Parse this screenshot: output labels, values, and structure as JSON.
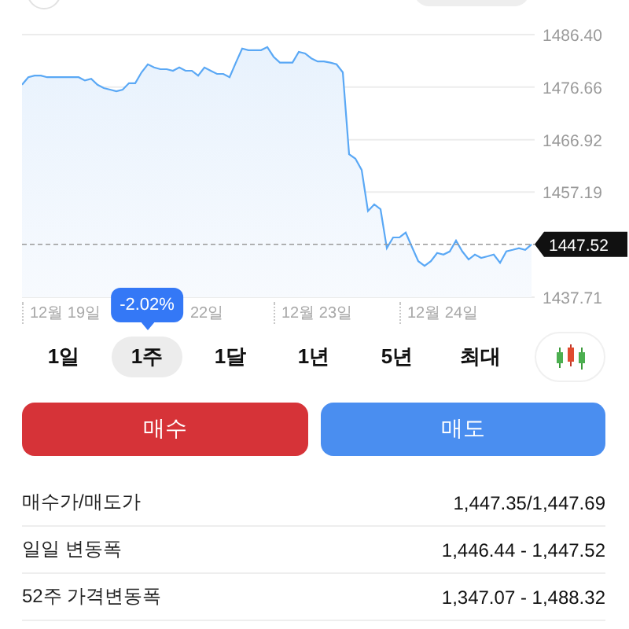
{
  "price_chart": {
    "chart_data": {
      "type": "area",
      "grid": true,
      "ylim": [
        1437.71,
        1486.4
      ],
      "yticks": [
        {
          "value": 1486.4,
          "label": "1486.40"
        },
        {
          "value": 1476.66,
          "label": "1476.66"
        },
        {
          "value": 1466.92,
          "label": "1466.92"
        },
        {
          "value": 1457.19,
          "label": "1457.19"
        },
        {
          "value": 1437.71,
          "label": "1437.71"
        }
      ],
      "series": [
        {
          "color": "#5aa8f5",
          "values": [
            1477.1,
            1478.5,
            1478.8,
            1478.8,
            1478.5,
            1478.5,
            1478.5,
            1478.5,
            1478.5,
            1478.5,
            1477.9,
            1478.2,
            1477.1,
            1476.5,
            1476.2,
            1475.9,
            1476.2,
            1477.4,
            1477.4,
            1479.4,
            1480.9,
            1480.3,
            1480.0,
            1480.0,
            1479.7,
            1480.3,
            1479.7,
            1479.7,
            1478.8,
            1480.3,
            1479.7,
            1479.1,
            1479.1,
            1478.5,
            1481.2,
            1483.8,
            1483.5,
            1483.5,
            1483.5,
            1484.1,
            1482.3,
            1481.2,
            1481.2,
            1481.2,
            1483.2,
            1482.9,
            1482.0,
            1481.4,
            1481.4,
            1481.2,
            1480.9,
            1479.4,
            1464.2,
            1463.4,
            1461.3,
            1453.7,
            1454.9,
            1454.0,
            1446.8,
            1448.8,
            1448.8,
            1449.7,
            1447.0,
            1444.4,
            1443.5,
            1444.4,
            1445.9,
            1445.6,
            1446.2,
            1448.2,
            1446.2,
            1444.7,
            1445.6,
            1445.0,
            1445.3,
            1445.6,
            1444.1,
            1446.2,
            1446.5,
            1446.8,
            1446.5,
            1447.52
          ]
        }
      ],
      "ref_lines": [
        {
          "axis": "y",
          "value": 1447.52,
          "label": "1447.52"
        }
      ]
    },
    "date_labels": [
      {
        "label": "12월 19일",
        "clipped": false
      },
      {
        "label": "22일",
        "clipped": true
      },
      {
        "label": "12월 23일",
        "clipped": false
      },
      {
        "label": "12월 24일",
        "clipped": false
      }
    ]
  },
  "range_tabs": [
    {
      "label": "1일",
      "selected": false
    },
    {
      "label": "1주",
      "selected": true,
      "tooltip": "-2.02%"
    },
    {
      "label": "1달",
      "selected": false
    },
    {
      "label": "1년",
      "selected": false
    },
    {
      "label": "5년",
      "selected": false
    },
    {
      "label": "최대",
      "selected": false
    }
  ],
  "chart_type_button": {
    "kind": "candlestick"
  },
  "trade_buttons": [
    {
      "kind": "buy",
      "label": "매수"
    },
    {
      "kind": "sell",
      "label": "매도"
    }
  ],
  "stats": [
    {
      "label": "매수가/매도가",
      "value": "1,447.35/1,447.69"
    },
    {
      "label": "일일 변동폭",
      "value": "1,446.44 - 1,447.52"
    },
    {
      "label": "52주 가격변동폭",
      "value": "1,347.07 - 1,488.32"
    }
  ]
}
